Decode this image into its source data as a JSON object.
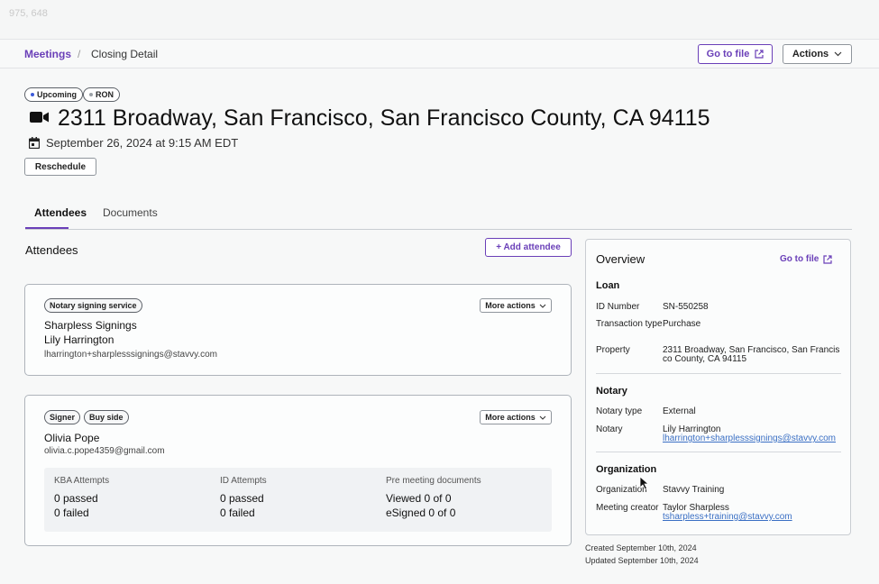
{
  "overlay": {
    "coords": "975, 648"
  },
  "breadcrumb": {
    "link": "Meetings",
    "separator": "/",
    "current": "Closing Detail"
  },
  "header_actions": {
    "goto_file": "Go to file",
    "actions": "Actions"
  },
  "badges": [
    "Upcoming",
    "RON"
  ],
  "colors": {
    "accent": "#6a3fb8",
    "badge_upcoming_dot": "#3d5bd9",
    "badge_ron_dot": "#9aa0a6",
    "link": "#3a6fc4"
  },
  "meeting": {
    "title": "2311 Broadway, San Francisco, San Francisco County, CA 94115",
    "date": "September 26, 2024 at 9:15 AM EDT",
    "reschedule": "Reschedule",
    "title_icon": "video-camera-icon",
    "date_icon": "calendar-icon"
  },
  "tabs": [
    {
      "label": "Attendees",
      "active": true
    },
    {
      "label": "Documents",
      "active": false
    }
  ],
  "attendees": {
    "heading": "Attendees",
    "add_button": "+ Add attendee",
    "cards": [
      {
        "tags": [
          "Notary signing service"
        ],
        "more": "More actions",
        "company": "Sharpless Signings",
        "name": "Lily Harrington",
        "email": "lharrington+sharplesssignings@stavvy.com"
      },
      {
        "tags": [
          "Signer",
          "Buy side"
        ],
        "more": "More actions",
        "name": "Olivia Pope",
        "email": "olivia.c.pope4359@gmail.com",
        "stats": [
          {
            "heading": "KBA Attempts",
            "line1": "0 passed",
            "line2": "0 failed"
          },
          {
            "heading": "ID Attempts",
            "line1": "0 passed",
            "line2": "0 failed"
          },
          {
            "heading": "Pre meeting documents",
            "line1": "Viewed 0 of 0",
            "line2": "eSigned 0 of 0"
          }
        ]
      }
    ]
  },
  "overview": {
    "title": "Overview",
    "goto_file": "Go to file",
    "loan": {
      "heading": "Loan",
      "id_label": "ID Number",
      "id_value": "SN-550258",
      "type_label": "Transaction type",
      "type_value": "Purchase",
      "property_label": "Property",
      "property_value": "2311 Broadway, San Francisco, San Francisco County, CA 94115"
    },
    "notary": {
      "heading": "Notary",
      "type_label": "Notary type",
      "type_value": "External",
      "notary_label": "Notary",
      "notary_name": "Lily Harrington",
      "notary_email": "lharrington+sharplesssignings@stavvy.com"
    },
    "organization": {
      "heading": "Organization",
      "org_label": "Organization",
      "org_value": "Stavvy Training",
      "creator_label": "Meeting creator",
      "creator_name": "Taylor Sharpless",
      "creator_email": "tsharpless+training@stavvy.com"
    }
  },
  "footer": {
    "created": "Created September 10th, 2024",
    "updated": "Updated September 10th, 2024"
  }
}
